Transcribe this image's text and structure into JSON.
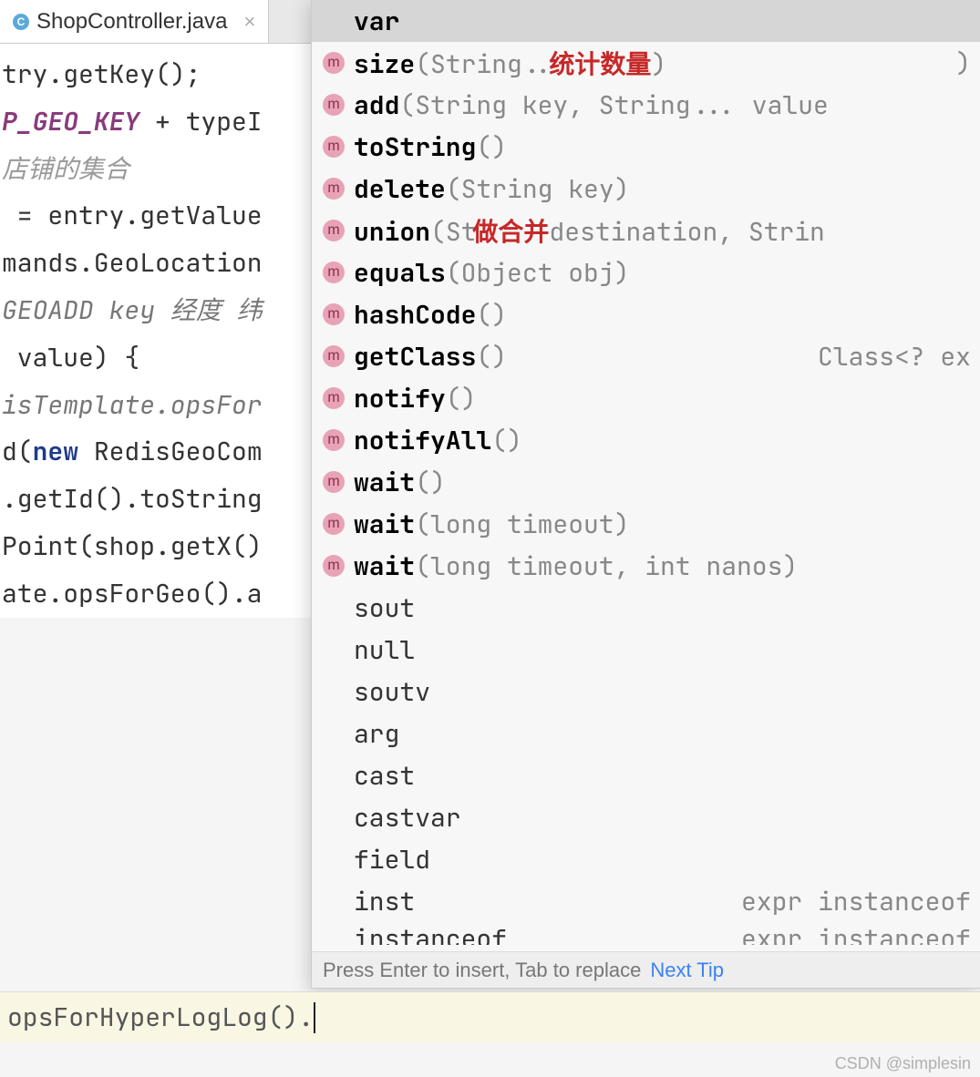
{
  "tab": {
    "icon_letter": "C",
    "title": "ShopController.java"
  },
  "editor_lines": [
    {
      "cls": "",
      "text": "try.getKey();"
    },
    {
      "cls": "",
      "html": "<span class='kw-purple-italic'>P_GEO_KEY</span> + typeI"
    },
    {
      "cls": "kw-cn-gray",
      "text": "店铺的集合"
    },
    {
      "cls": "",
      "text": " = entry.getValue"
    },
    {
      "cls": "",
      "text": "mands.GeoLocation"
    },
    {
      "cls": "",
      "html": "<span class='kw-italic'>GEOADD key 经度 纬</span>"
    },
    {
      "cls": "",
      "text": " value) {"
    },
    {
      "cls": "kw-italic",
      "text": "isTemplate.opsFor"
    },
    {
      "cls": "",
      "html": "d(<span class='kw-blue'>new</span> RedisGeoCom"
    },
    {
      "cls": "",
      "text": ".getId().toString"
    },
    {
      "cls": "",
      "text": "Point(shop.getX()"
    },
    {
      "cls": "",
      "text": ""
    },
    {
      "cls": "",
      "text": ""
    },
    {
      "cls": "",
      "text": "ate.opsForGeo().a"
    }
  ],
  "popup": {
    "selected_index": 0,
    "items": [
      {
        "kind": "var",
        "name": "var",
        "params": "",
        "right": "",
        "annot": ""
      },
      {
        "kind": "m",
        "name": "size",
        "params": "(String..",
        "right": ")",
        "annot": "统计数量"
      },
      {
        "kind": "m",
        "name": "add",
        "params": "(String key, String... value",
        "right": "",
        "annot": ""
      },
      {
        "kind": "m",
        "name": "toString",
        "params": "()",
        "right": "",
        "annot": ""
      },
      {
        "kind": "m",
        "name": "delete",
        "params": "(String key)",
        "right": "",
        "annot": ""
      },
      {
        "kind": "m",
        "name": "union",
        "params": "(St       destination, Strin",
        "right": "",
        "annot": "做合并"
      },
      {
        "kind": "m",
        "name": "equals",
        "params": "(Object obj)",
        "right": "",
        "annot": ""
      },
      {
        "kind": "m",
        "name": "hashCode",
        "params": "()",
        "right": "",
        "annot": ""
      },
      {
        "kind": "m",
        "name": "getClass",
        "params": "()",
        "right": "Class<? ex",
        "annot": ""
      },
      {
        "kind": "m",
        "name": "notify",
        "params": "()",
        "right": "",
        "annot": ""
      },
      {
        "kind": "m",
        "name": "notifyAll",
        "params": "()",
        "right": "",
        "annot": ""
      },
      {
        "kind": "m",
        "name": "wait",
        "params": "()",
        "right": "",
        "annot": ""
      },
      {
        "kind": "m",
        "name": "wait",
        "params": "(long timeout)",
        "right": "",
        "annot": ""
      },
      {
        "kind": "m",
        "name": "wait",
        "params": "(long timeout, int nanos)",
        "right": "",
        "annot": ""
      },
      {
        "kind": "tpl",
        "name": "sout",
        "params": "",
        "right": "",
        "annot": ""
      },
      {
        "kind": "tpl",
        "name": "null",
        "params": "",
        "right": "",
        "annot": ""
      },
      {
        "kind": "tpl",
        "name": "soutv",
        "params": "",
        "right": "",
        "annot": ""
      },
      {
        "kind": "tpl",
        "name": "arg",
        "params": "",
        "right": "",
        "annot": ""
      },
      {
        "kind": "tpl",
        "name": "cast",
        "params": "",
        "right": "",
        "annot": ""
      },
      {
        "kind": "tpl",
        "name": "castvar",
        "params": "",
        "right": "",
        "annot": ""
      },
      {
        "kind": "tpl",
        "name": "field",
        "params": "",
        "right": "",
        "annot": ""
      },
      {
        "kind": "tpl",
        "name": "inst",
        "params": "",
        "right": "expr instanceof",
        "annot": ""
      },
      {
        "kind": "tpl",
        "name": "instanceof",
        "params": "",
        "right": "expr instanceof",
        "annot": "",
        "cutoff": true
      }
    ],
    "footer_hint": "Press Enter to insert, Tab to replace",
    "next_tip": "Next Tip"
  },
  "status_bar": {
    "text": "opsForHyperLogLog()."
  },
  "watermark": "CSDN @simplesin"
}
